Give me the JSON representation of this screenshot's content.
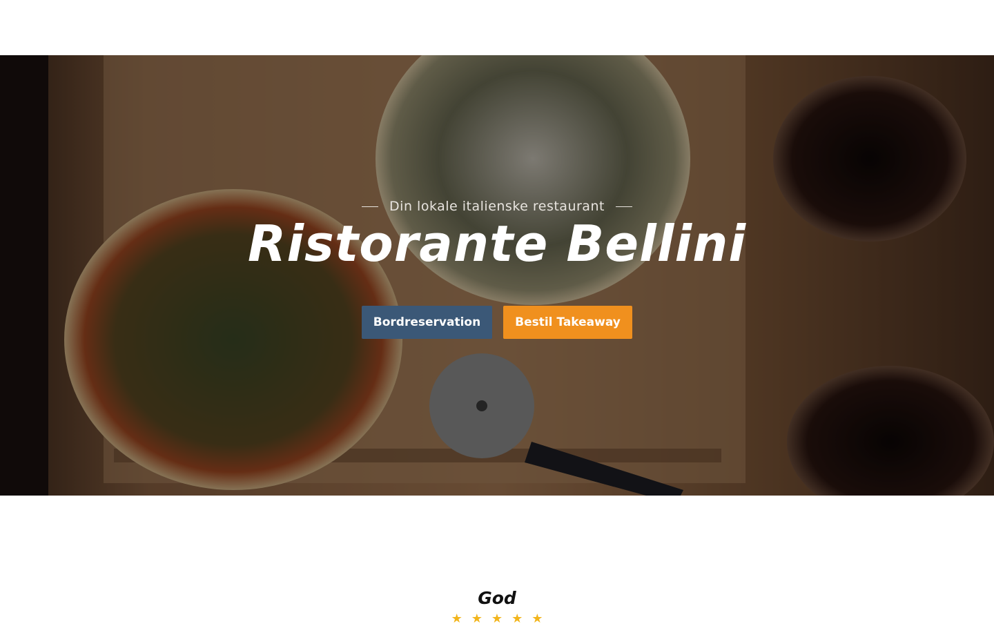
{
  "hero": {
    "tagline": "Din lokale italienske restaurant",
    "title": "Ristorante Bellini",
    "buttons": {
      "reserve_label": "Bordreservation",
      "takeaway_label": "Bestil Takeaway"
    }
  },
  "rating": {
    "title": "God",
    "stars": 5,
    "star_glyph": "★"
  },
  "colors": {
    "reserve_button": "#3b5877",
    "takeaway_button": "#f0901e",
    "star": "#f2b51c"
  }
}
